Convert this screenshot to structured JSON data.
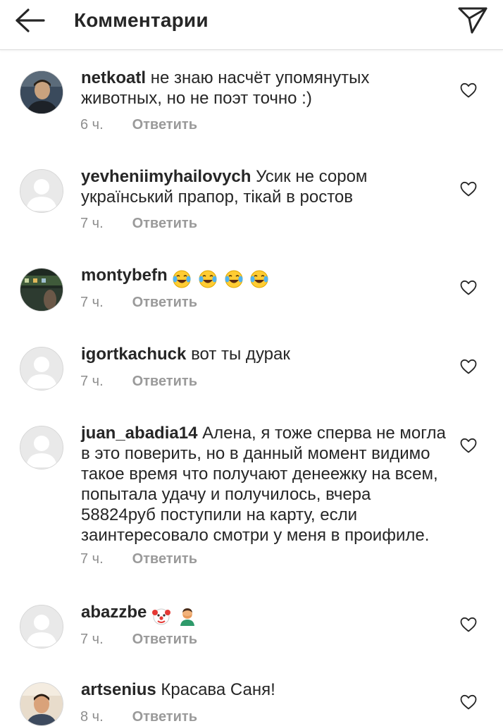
{
  "header": {
    "back_icon": "arrow-left-icon",
    "title": "Комментарии",
    "share_icon": "paper-plane-icon"
  },
  "reply_label": "Ответить",
  "like_icon": "heart-outline-icon",
  "comments": [
    {
      "username": "netkoatl",
      "text": "не знаю насчёт упомянутых животных, но не поэт точно :)",
      "time": "6 ч.",
      "avatar": "photo"
    },
    {
      "username": "yevheniimyhailovych",
      "text": "Усик не сором український прапор, тікай в ростов",
      "time": "7 ч.",
      "avatar": "default"
    },
    {
      "username": "montybefn",
      "text": "",
      "emoji": [
        "face-with-tears-of-joy",
        "face-with-tears-of-joy",
        "face-with-tears-of-joy",
        "face-with-tears-of-joy"
      ],
      "time": "7 ч.",
      "avatar": "photo"
    },
    {
      "username": "igortkachuck",
      "text": "вот ты дурак",
      "time": "7 ч.",
      "avatar": "default"
    },
    {
      "username": "juan_abadia14",
      "text": "Алена, я тоже сперва не могла в это поверить, но в данный момент видимо такое время что получают денеежку на всем, попытала удачу и получилось, вчера 58824руб поступили на карту, если заинтересовало смотри у меня в проифиле.",
      "time": "7 ч.",
      "avatar": "default"
    },
    {
      "username": "abazzbe",
      "text": "",
      "emoji": [
        "clown-face",
        "person-facepalming"
      ],
      "time": "7 ч.",
      "avatar": "default"
    },
    {
      "username": "artsenius",
      "text": "Красава Саня!",
      "time": "8 ч.",
      "avatar": "photo"
    }
  ]
}
